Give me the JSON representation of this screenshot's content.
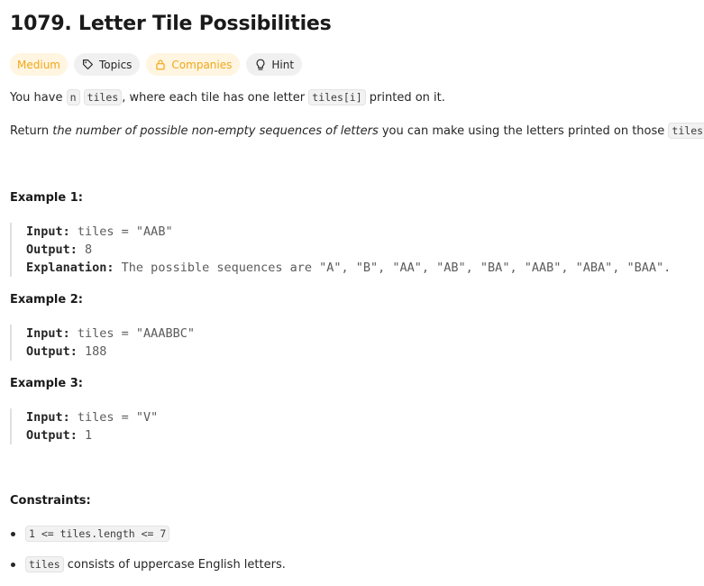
{
  "problem": {
    "title": "1079. Letter Tile Possibilities",
    "tags": {
      "difficulty": "Medium",
      "topics": "Topics",
      "companies": "Companies",
      "hint": "Hint"
    },
    "colors": {
      "difficulty_text": "#f0a81c",
      "difficulty_bg": "#fff5e0",
      "chip_bg": "#f0f0f0"
    },
    "icons": {
      "topics": "tag-icon",
      "companies": "lock-icon",
      "hint": "lightbulb-icon"
    },
    "description": {
      "p1": {
        "t1": "You have ",
        "c1": "n",
        "t2": " ",
        "c2": "tiles",
        "t3": ", where each tile has one letter ",
        "c3": "tiles[i]",
        "t4": " printed on it."
      },
      "p2": {
        "t1": "Return ",
        "em": "the number of possible non-empty sequences of letters",
        "t2": " you can make using the letters printed on those ",
        "c1": "tiles",
        "t3": "."
      }
    },
    "examples": [
      {
        "title": "Example 1:",
        "input_label": "Input:",
        "input": " tiles = \"AAB\"",
        "output_label": "Output:",
        "output": " 8",
        "explanation_label": "Explanation:",
        "explanation": " The possible sequences are \"A\", \"B\", \"AA\", \"AB\", \"BA\", \"AAB\", \"ABA\", \"BAA\"."
      },
      {
        "title": "Example 2:",
        "input_label": "Input:",
        "input": " tiles = \"AAABBC\"",
        "output_label": "Output:",
        "output": " 188"
      },
      {
        "title": "Example 3:",
        "input_label": "Input:",
        "input": " tiles = \"V\"",
        "output_label": "Output:",
        "output": " 1"
      }
    ],
    "constraints": {
      "title": "Constraints:",
      "items": [
        {
          "code": "1 <= tiles.length <= 7",
          "text": ""
        },
        {
          "code": "tiles",
          "text": " consists of uppercase English letters."
        }
      ]
    }
  }
}
